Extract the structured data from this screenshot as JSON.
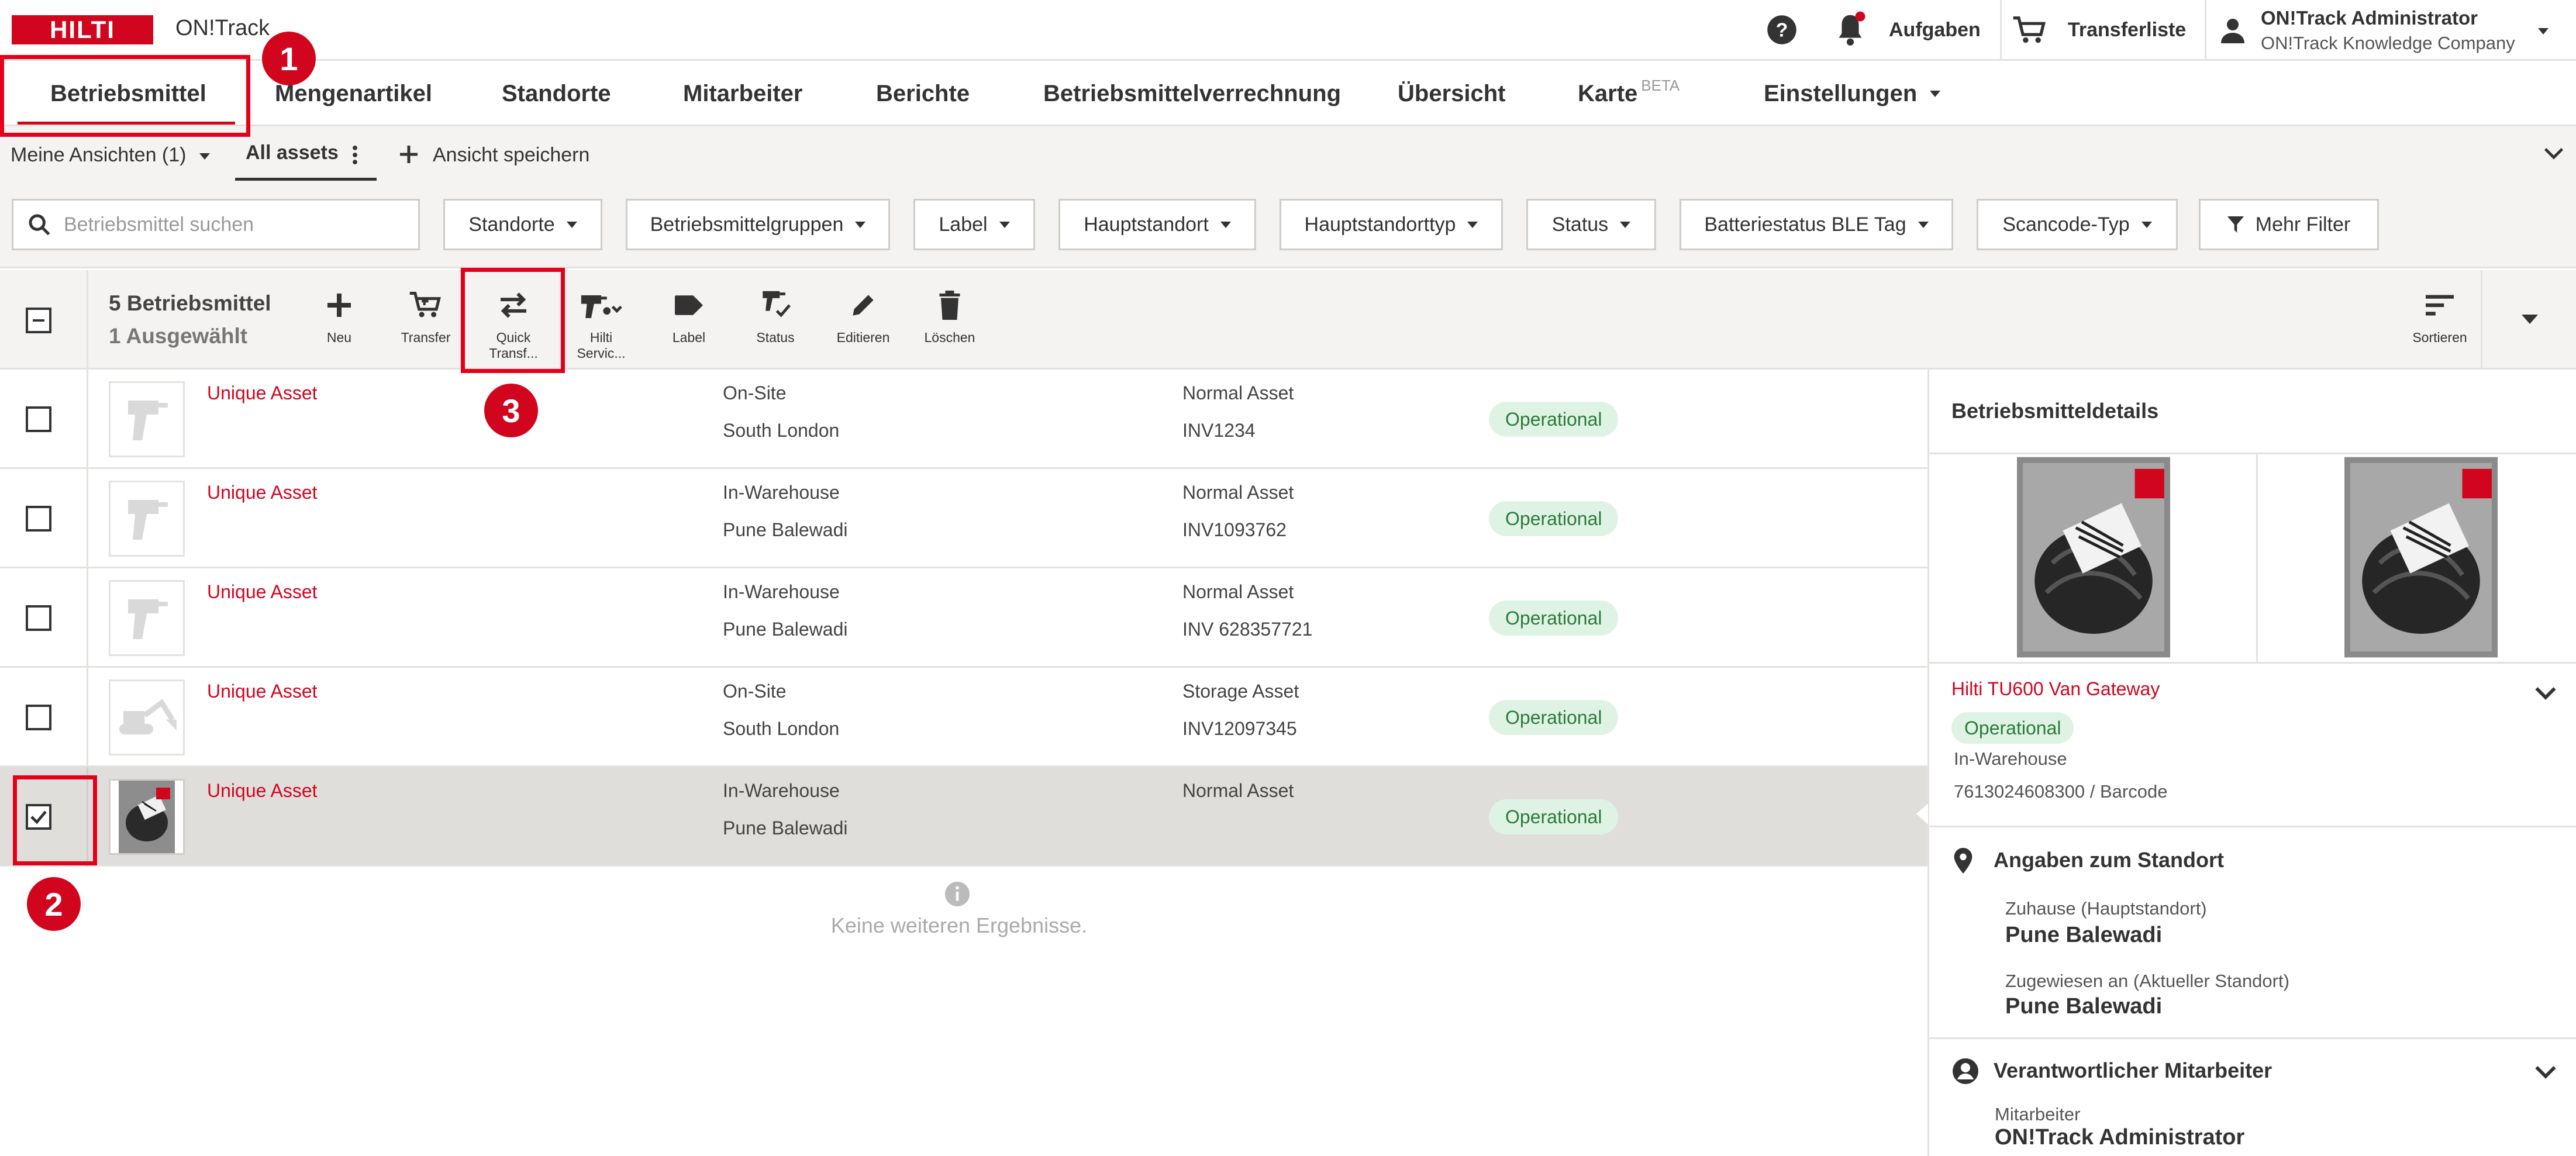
{
  "header": {
    "logo_text": "HILTI",
    "app_name": "ON!Track",
    "help_icon": "help-circle-icon",
    "notifications_label": "Aufgaben",
    "transfer_list_label": "Transferliste",
    "user_name": "ON!Track Administrator",
    "company_name": "ON!Track Knowledge Company"
  },
  "nav": {
    "tabs": [
      {
        "label": "Betriebsmittel"
      },
      {
        "label": "Mengenartikel"
      },
      {
        "label": "Standorte"
      },
      {
        "label": "Mitarbeiter"
      },
      {
        "label": "Berichte"
      },
      {
        "label": "Betriebsmittelverrechnung"
      },
      {
        "label": "Übersicht"
      },
      {
        "label": "Karte",
        "badge": "BETA"
      },
      {
        "label": "Einstellungen"
      }
    ]
  },
  "views": {
    "my_views": "Meine Ansichten (1)",
    "active_view": "All assets",
    "save_view": "Ansicht speichern"
  },
  "filters": {
    "search_placeholder": "Betriebsmittel suchen",
    "items": [
      "Standorte",
      "Betriebsmittelgruppen",
      "Label",
      "Hauptstandort",
      "Hauptstandorttyp",
      "Status",
      "Batteriestatus BLE Tag",
      "Scancode-Typ"
    ],
    "more": "Mehr Filter"
  },
  "toolbar": {
    "count": "5 Betriebsmittel",
    "selected": "1 Ausgewählt",
    "actions": [
      {
        "label": "Neu",
        "icon": "plus-icon"
      },
      {
        "label": "Transfer",
        "icon": "cart-transfer-icon"
      },
      {
        "label": "Quick Transf...",
        "icon": "swap-arrows-icon"
      },
      {
        "label": "Hilti Servic...",
        "icon": "drill-service-icon"
      },
      {
        "label": "Label",
        "icon": "tag-icon"
      },
      {
        "label": "Status",
        "icon": "status-tool-icon"
      },
      {
        "label": "Editieren",
        "icon": "pencil-icon"
      },
      {
        "label": "Löschen",
        "icon": "trash-icon"
      }
    ],
    "sort_label": "Sortieren"
  },
  "assets": [
    {
      "name": "Unique Asset",
      "state": "On-Site",
      "location": "South London",
      "type": "Normal Asset",
      "code": "INV1234",
      "status": "Operational",
      "thumb": "drill",
      "checked": false
    },
    {
      "name": "Unique Asset",
      "state": "In-Warehouse",
      "location": "Pune Balewadi",
      "type": "Normal Asset",
      "code": "INV1093762",
      "status": "Operational",
      "thumb": "drill",
      "checked": false
    },
    {
      "name": "Unique Asset",
      "state": "In-Warehouse",
      "location": "Pune Balewadi",
      "type": "Normal Asset",
      "code": "INV 628357721",
      "status": "Operational",
      "thumb": "drill",
      "checked": false
    },
    {
      "name": "Unique Asset",
      "state": "On-Site",
      "location": "South London",
      "type": "Storage Asset",
      "code": "INV12097345",
      "status": "Operational",
      "thumb": "excavator",
      "checked": false
    },
    {
      "name": "Unique Asset",
      "state": "In-Warehouse",
      "location": "Pune Balewadi",
      "type": "Normal Asset",
      "code": "",
      "status": "Operational",
      "thumb": "photo",
      "checked": true
    }
  ],
  "no_more_results": "Keine weiteren Ergebnisse.",
  "detail": {
    "title": "Betriebsmitteldetails",
    "asset_name": "Hilti TU600 Van Gateway",
    "status": "Operational",
    "state": "In-Warehouse",
    "scancode": "7613024608300 / Barcode",
    "location_section": "Angaben zum Standort",
    "home_label": "Zuhause (Hauptstandort)",
    "home_value": "Pune Balewadi",
    "assigned_label": "Zugewiesen an (Aktueller Standort)",
    "assigned_value": "Pune Balewadi",
    "responsible_section": "Verantwortlicher Mitarbeiter",
    "employee_label": "Mitarbeiter",
    "employee_value": "ON!Track Administrator"
  },
  "annotations": [
    "1",
    "2",
    "3"
  ],
  "colors": {
    "brand_red": "#d2051e",
    "badge_green_bg": "#dff3e4",
    "badge_green_text": "#2b7a3b",
    "bar_bg": "#f4f3f1",
    "selected_row": "#e0dedb"
  }
}
